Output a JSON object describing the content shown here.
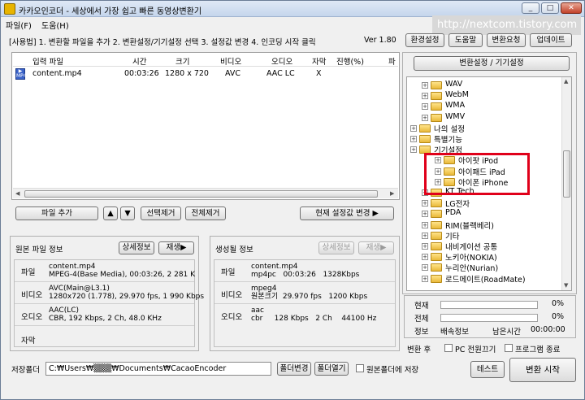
{
  "window": {
    "title": "카카오인코더 - 세상에서 가장 쉽고 빠른 동영상변환기",
    "min": "_",
    "max": "□",
    "close": "✕"
  },
  "menu": {
    "file": "파일(F)",
    "help": "도움(H)"
  },
  "watermark": "http://nextcom.tistory.com",
  "instructions": "[사용법] 1. 변환할 파일을 추가  2. 변환설정/기기설정 선택  3. 설정값 변경  4. 인코딩 시작 클릭",
  "version": "Ver 1.80",
  "toolbar": {
    "env": "환경설정",
    "help": "도움말",
    "request": "변환요청",
    "update": "업데이트"
  },
  "file_table": {
    "headers": [
      "입력 파일",
      "시간",
      "크기",
      "비디오",
      "오디오",
      "자막",
      "진행(%)",
      "파"
    ],
    "rows": [
      {
        "icon": "mp4-icon",
        "name": "content.mp4",
        "time": "00:03:26",
        "size": "1280 x 720",
        "video": "AVC",
        "audio": "AAC LC",
        "sub": "X",
        "progress": ""
      }
    ]
  },
  "file_buttons": {
    "add": "파일 추가",
    "up": "▲",
    "down": "▼",
    "remove_sel": "선택제거",
    "remove_all": "전체제거",
    "apply": "현재 설정값 변경 ▶"
  },
  "source_info": {
    "title": "원본 파일 정보",
    "detail_btn": "상세정보",
    "play_btn": "재생▶",
    "file_label": "파일",
    "file_val": "content.mp4\nMPEG-4(Base Media), 00:03:26, 2 281 K",
    "video_label": "비디오",
    "video_val": "AVC(Main@L3.1)\n1280x720 (1.778), 29.970 fps, 1 990 Kbps",
    "audio_label": "오디오",
    "audio_val": "AAC(LC)\nCBR, 192 Kbps, 2 Ch, 48.0 KHz",
    "sub_label": "자막"
  },
  "output_info": {
    "title": "생성될 정보",
    "detail_btn": "상세정보",
    "play_btn": "재생▶",
    "file_label": "파일",
    "file_val": "content.mp4\nmp4pc   00:03:26   1328Kbps",
    "video_label": "비디오",
    "video_val": "mpeg4\n원본크기  29.970 fps   1200 Kbps",
    "audio_label": "오디오",
    "audio_val": "aac\ncbr     128 Kbps   2 Ch    44100 Hz"
  },
  "settings": {
    "header_btn": "변환설정 / 기기설정",
    "tree": [
      {
        "label": "WAV",
        "indent": 1
      },
      {
        "label": "WebM",
        "indent": 1
      },
      {
        "label": "WMA",
        "indent": 1
      },
      {
        "label": "WMV",
        "indent": 1
      },
      {
        "label": "나의 설정",
        "indent": 0
      },
      {
        "label": "특별기능",
        "indent": 0
      },
      {
        "label": "기기설정",
        "indent": 0
      },
      {
        "label": "아이팟 iPod",
        "indent": 2
      },
      {
        "label": "아이패드 iPad",
        "indent": 2
      },
      {
        "label": "아이폰 iPhone",
        "indent": 2
      },
      {
        "label": "KT Tech",
        "indent": 1
      },
      {
        "label": "LG전자",
        "indent": 1
      },
      {
        "label": "PDA",
        "indent": 1
      },
      {
        "label": "RIM(블랙베리)",
        "indent": 1
      },
      {
        "label": "기타",
        "indent": 1
      },
      {
        "label": "내비게이션 공통",
        "indent": 1
      },
      {
        "label": "노키아(NOKIA)",
        "indent": 1
      },
      {
        "label": "누리안(Nurian)",
        "indent": 1
      },
      {
        "label": "로드메이트(RoadMate)",
        "indent": 1
      }
    ]
  },
  "status": {
    "current_label": "현재",
    "current_pct": "0%",
    "current_value": 0,
    "total_label": "전체",
    "total_pct": "0%",
    "total_value": 0,
    "info_label": "정보",
    "speed_label": "배속정보",
    "remain_label": "남은시간",
    "remain_val": "00:00:00"
  },
  "after": {
    "label": "변환 후",
    "pc_off": "PC 전원끄기",
    "prog_exit": "프로그램 종료"
  },
  "save": {
    "label": "저장폴더",
    "path": "C:₩Users₩▒▒▒₩Documents₩CacaoEncoder",
    "change": "폴더변경",
    "open": "폴더열기",
    "save_orig": "원본폴더에 저장"
  },
  "bottom": {
    "test": "테스트",
    "start": "변환 시작"
  }
}
